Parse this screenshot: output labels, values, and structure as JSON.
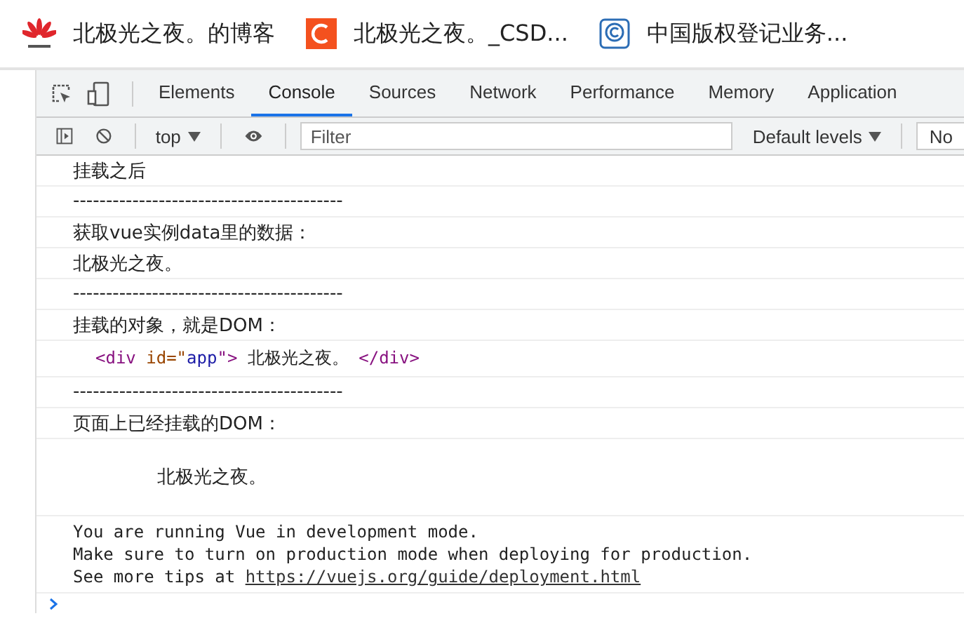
{
  "bookmarks": [
    {
      "label": "北极光之夜。的博客"
    },
    {
      "label": "北极光之夜。_CSD..."
    },
    {
      "label": "中国版权登记业务..."
    }
  ],
  "devtools": {
    "tabs": [
      {
        "label": "Elements",
        "selected": false
      },
      {
        "label": "Console",
        "selected": true
      },
      {
        "label": "Sources",
        "selected": false
      },
      {
        "label": "Network",
        "selected": false
      },
      {
        "label": "Performance",
        "selected": false
      },
      {
        "label": "Memory",
        "selected": false
      },
      {
        "label": "Application",
        "selected": false
      }
    ],
    "toolbar": {
      "context": "top",
      "filter": {
        "placeholder": "Filter"
      },
      "levels": "Default levels",
      "issues": "No"
    }
  },
  "console": {
    "messages": [
      {
        "kind": "text",
        "text": "挂载之后"
      },
      {
        "kind": "text",
        "text": "-----------------------------------------"
      },
      {
        "kind": "text",
        "text": "获取vue实例data里的数据："
      },
      {
        "kind": "text",
        "text": "北极光之夜。"
      },
      {
        "kind": "text",
        "text": "-----------------------------------------"
      },
      {
        "kind": "text",
        "text": "挂载的对象，就是DOM："
      },
      {
        "kind": "element",
        "segments": [
          {
            "kind": "tag",
            "text": "<div"
          },
          {
            "kind": "attr",
            "text": " id=\""
          },
          {
            "kind": "value",
            "text": "app"
          },
          {
            "kind": "tag",
            "text": "\">"
          },
          {
            "kind": "text",
            "text": " 北极光之夜。 "
          },
          {
            "kind": "tag",
            "text": "</div>"
          }
        ]
      },
      {
        "kind": "text",
        "text": "-----------------------------------------"
      },
      {
        "kind": "text",
        "text": "页面上已经挂载的DOM："
      },
      {
        "kind": "dom",
        "text": "北极光之夜。"
      },
      {
        "kind": "info",
        "lines": [
          {
            "text": "You are running Vue in development mode."
          },
          {
            "text": "Make sure to turn on production mode when deploying for production."
          },
          {
            "text": "See more tips at ",
            "link": "https://vuejs.org/guide/deployment.html"
          }
        ]
      }
    ]
  }
}
